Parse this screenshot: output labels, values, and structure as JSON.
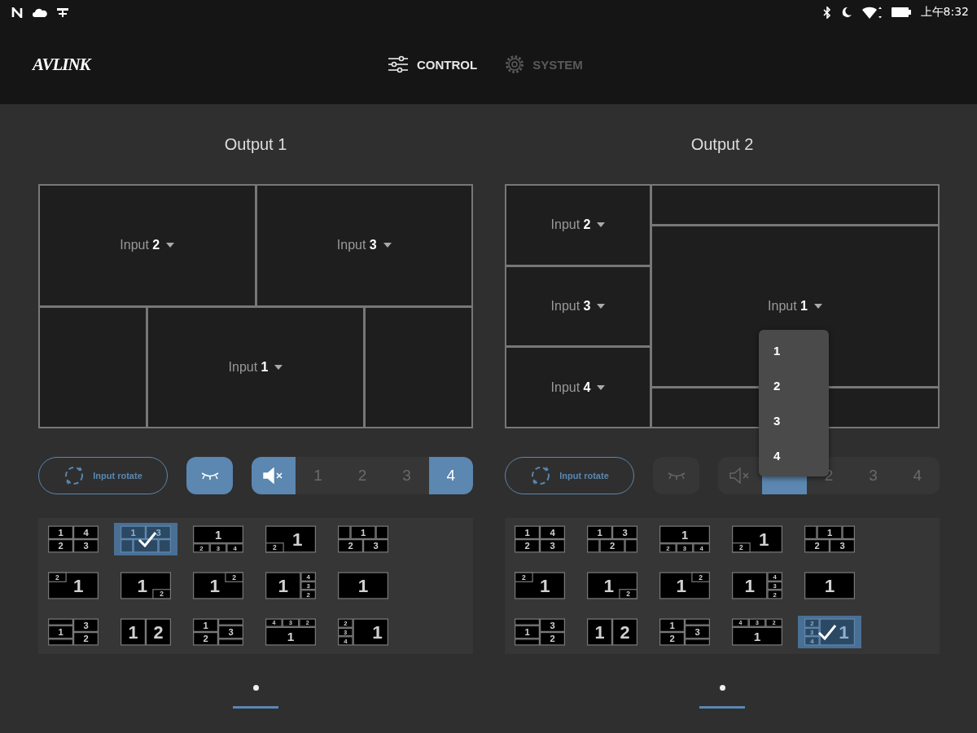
{
  "status_bar": {
    "time": "上午8:32"
  },
  "header": {
    "logo": "AVLINK",
    "tabs": [
      {
        "kind": "sliders",
        "label": "CONTROL",
        "selected": true
      },
      {
        "kind": "gear",
        "label": "SYSTEM",
        "selected": false
      }
    ]
  },
  "outputs": [
    {
      "title": "Output 1",
      "kind": "top2-bottom1",
      "windows": [
        {
          "text": "Input **2**"
        },
        {
          "text": "Input **3**"
        },
        {
          "text": "Input **1**"
        }
      ],
      "rotate_button": "Input rotate",
      "freeze": {
        "on": true
      },
      "mute": {
        "on": true
      },
      "sources": [
        {
          "label": "1",
          "selected": false
        },
        {
          "label": "2",
          "selected": false
        },
        {
          "label": "3",
          "selected": false
        },
        {
          "label": "4",
          "selected": true
        }
      ],
      "layouts": [
        {
          "kind": "quad",
          "labels": [
            "1",
            "4",
            "2",
            "3"
          ],
          "selected": false
        },
        {
          "kind": "top2-bottom1",
          "labels": [
            "1",
            "3"
          ],
          "selected": true
        },
        {
          "kind": "top1-bottom3",
          "labels": [
            "1",
            "2",
            "3",
            "4"
          ],
          "selected": false
        },
        {
          "kind": "pip-bl",
          "labels": [
            "2",
            "1"
          ],
          "selected": false
        },
        {
          "kind": "top1-bottom2",
          "labels": [
            "1",
            "2",
            "3"
          ],
          "selected": false
        },
        {
          "kind": "pip-tl",
          "labels": [
            "2",
            "1"
          ],
          "selected": false
        },
        {
          "kind": "pip-br",
          "labels": [
            "1",
            "2"
          ],
          "selected": false
        },
        {
          "kind": "pip-tr",
          "labels": [
            "1",
            "2"
          ],
          "selected": false
        },
        {
          "kind": "left1-right3",
          "labels": [
            "1",
            "4",
            "3",
            "2"
          ],
          "selected": false
        },
        {
          "kind": "single",
          "labels": [
            "1"
          ],
          "selected": false
        },
        {
          "kind": "band-left",
          "labels": [
            "1",
            "3",
            "2"
          ],
          "selected": false
        },
        {
          "kind": "split2",
          "labels": [
            "1",
            "2"
          ],
          "selected": false
        },
        {
          "kind": "band-right",
          "labels": [
            "1",
            "2",
            "3"
          ],
          "selected": false
        },
        {
          "kind": "top3-bottom1",
          "labels": [
            "4",
            "3",
            "2",
            "1"
          ],
          "selected": false
        },
        {
          "kind": "left3-right1",
          "labels": [
            "2",
            "3",
            "4",
            "1"
          ],
          "selected": false
        }
      ]
    },
    {
      "title": "Output 2",
      "kind": "left3-right1",
      "windows": [
        {
          "text": "Input **2**"
        },
        {
          "text": "Input **3**"
        },
        {
          "text": "Input **4**"
        },
        {
          "text": "Input **1**"
        }
      ],
      "dropdown": {
        "options": [
          "1",
          "2",
          "3",
          "4"
        ]
      },
      "rotate_button": "Input rotate",
      "freeze": {
        "on": false
      },
      "mute": {
        "on": false
      },
      "sources": [
        {
          "selected": true
        },
        {
          "label": "2",
          "selected": false
        },
        {
          "label": "3",
          "selected": false
        },
        {
          "label": "4",
          "selected": false
        }
      ],
      "layouts": [
        {
          "kind": "quad",
          "labels": [
            "1",
            "4",
            "2",
            "3"
          ],
          "selected": false
        },
        {
          "kind": "top2-bottom1",
          "labels": [
            "1",
            "3",
            "2"
          ],
          "selected": false
        },
        {
          "kind": "top1-bottom3",
          "labels": [
            "1",
            "2",
            "3",
            "4"
          ],
          "selected": false
        },
        {
          "kind": "pip-bl",
          "labels": [
            "2",
            "1"
          ],
          "selected": false
        },
        {
          "kind": "top1-bottom2",
          "labels": [
            "1",
            "2",
            "3"
          ],
          "selected": false
        },
        {
          "kind": "pip-tl",
          "labels": [
            "2",
            "1"
          ],
          "selected": false
        },
        {
          "kind": "pip-br",
          "labels": [
            "1",
            "2"
          ],
          "selected": false
        },
        {
          "kind": "pip-tr",
          "labels": [
            "1",
            "2"
          ],
          "selected": false
        },
        {
          "kind": "left1-right3",
          "labels": [
            "1",
            "4",
            "3",
            "2"
          ],
          "selected": false
        },
        {
          "kind": "single",
          "labels": [
            "1"
          ],
          "selected": false
        },
        {
          "kind": "band-left",
          "labels": [
            "1",
            "3",
            "2"
          ],
          "selected": false
        },
        {
          "kind": "split2",
          "labels": [
            "1",
            "2"
          ],
          "selected": false
        },
        {
          "kind": "band-right",
          "labels": [
            "1",
            "2",
            "3"
          ],
          "selected": false
        },
        {
          "kind": "top3-bottom1",
          "labels": [
            "4",
            "3",
            "2",
            "1"
          ],
          "selected": false
        },
        {
          "kind": "left3-right1",
          "labels": [
            "2",
            "3",
            "4",
            "1"
          ],
          "selected": true
        }
      ]
    }
  ]
}
